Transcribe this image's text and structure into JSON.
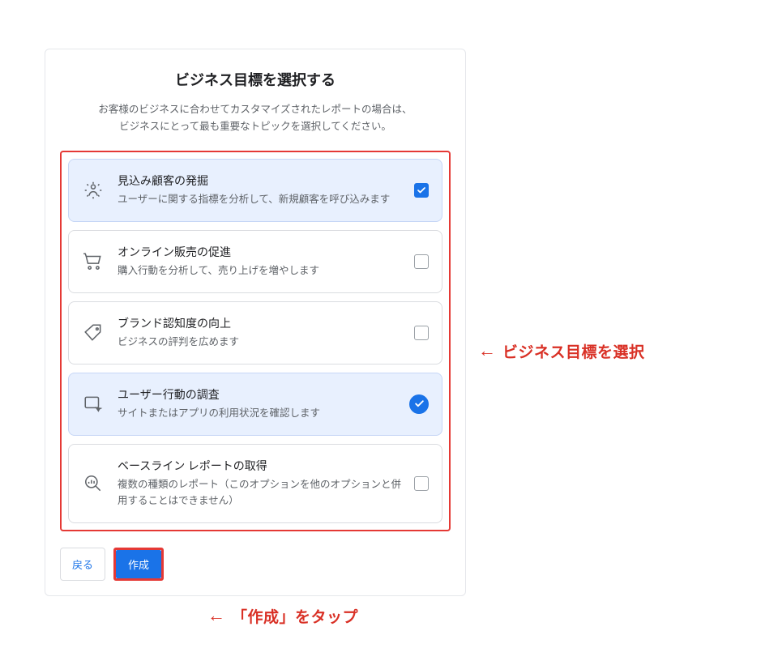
{
  "panel": {
    "title": "ビジネス目標を選択する",
    "subtitle_line1": "お客様のビジネスに合わせてカスタマイズされたレポートの場合は、",
    "subtitle_line2": "ビジネスにとって最も重要なトピックを選択してください。"
  },
  "options": [
    {
      "icon": "person-target-icon",
      "title": "見込み顧客の発掘",
      "desc": "ユーザーに関する指標を分析して、新規顧客を呼び込みます",
      "checked": true,
      "rounded_check": false
    },
    {
      "icon": "cart-icon",
      "title": "オンライン販売の促進",
      "desc": "購入行動を分析して、売り上げを増やします",
      "checked": false,
      "rounded_check": false
    },
    {
      "icon": "tag-icon",
      "title": "ブランド認知度の向上",
      "desc": "ビジネスの評判を広めます",
      "checked": false,
      "rounded_check": false
    },
    {
      "icon": "device-pointer-icon",
      "title": "ユーザー行動の調査",
      "desc": "サイトまたはアプリの利用状況を確認します",
      "checked": true,
      "rounded_check": true
    },
    {
      "icon": "magnify-chart-icon",
      "title": "ベースライン レポートの取得",
      "desc": "複数の種類のレポート（このオプションを他のオプションと併用することはできません）",
      "checked": false,
      "rounded_check": false
    }
  ],
  "buttons": {
    "back": "戻る",
    "create": "作成"
  },
  "annotations": {
    "select_goal": "ビジネス目標を選択",
    "tap_create": "「作成」をタップ",
    "arrow": "←"
  },
  "colors": {
    "accent": "#1a73e8",
    "highlight": "#e53935"
  }
}
